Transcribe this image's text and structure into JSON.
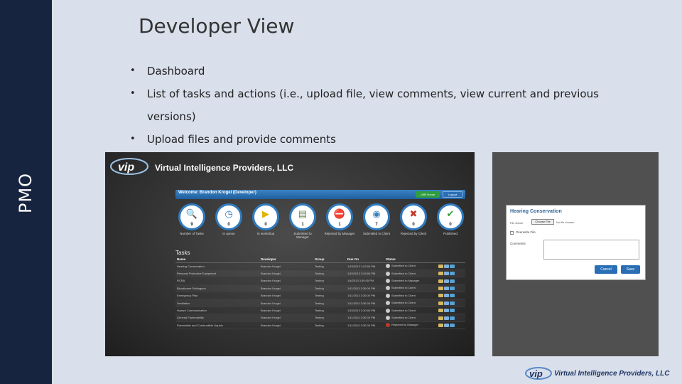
{
  "sidebar": {
    "label": "PMO"
  },
  "slide": {
    "title": "Developer View",
    "bullets": [
      "Dashboard",
      "List of tasks and actions (i.e., upload file, view comments, view current and previous versions)",
      "Upload files and provide comments"
    ]
  },
  "dashboard": {
    "company": "Virtual Intelligence Providers, LLC",
    "welcome": "Welcome: Brandon Krogel (Developer)",
    "lmr_button": "LMR Home",
    "logout_button": "Logout",
    "stats": [
      {
        "count": "9",
        "label": "Number of Tasks",
        "icon": "magnifier-icon"
      },
      {
        "count": "0",
        "label": "In queue",
        "icon": "clock-icon"
      },
      {
        "count": "0",
        "label": "In workshop",
        "icon": "play-icon"
      },
      {
        "count": "1",
        "label": "Submitted to Manager",
        "icon": "document-icon"
      },
      {
        "count": "1",
        "label": "Rejected by Manager",
        "icon": "stop-icon"
      },
      {
        "count": "7",
        "label": "Submitted to Client",
        "icon": "globe-icon"
      },
      {
        "count": "0",
        "label": "Rejected by Client",
        "icon": "x-icon"
      },
      {
        "count": "0",
        "label": "Published",
        "icon": "check-icon"
      }
    ],
    "tasks_title": "Tasks",
    "columns": [
      "Name",
      "Developer",
      "Group",
      "Due On",
      "Status"
    ],
    "rows": [
      {
        "name": "Hearing Conservation",
        "developer": "Brandon Krogel",
        "group": "Testing",
        "due": "1/15/2013 1:03:00 PM",
        "status": "Submitted to Client"
      },
      {
        "name": "Personal Protective Equipment",
        "developer": "Brandon Krogel",
        "group": "Testing",
        "due": "1/15/2013 2:03:00 PM",
        "status": "Submitted to Client"
      },
      {
        "name": "RCRA",
        "developer": "Brandon Krogel",
        "group": "Testing",
        "due": "1/4/2013 3:30:00 PM",
        "status": "Submitted to Manager"
      },
      {
        "name": "Bloodborne Pathogens",
        "developer": "Brandon Krogel",
        "group": "Testing",
        "due": "1/11/2013 3:30:00 PM",
        "status": "Submitted to Client"
      },
      {
        "name": "Emergency Plan",
        "developer": "Brandon Krogel",
        "group": "Testing",
        "due": "1/11/2013 3:30:00 PM",
        "status": "Submitted to Client"
      },
      {
        "name": "Ventilation",
        "developer": "Brandon Krogel",
        "group": "Testing",
        "due": "1/11/2013 3:30:00 PM",
        "status": "Submitted to Client"
      },
      {
        "name": "Hazard Communication",
        "developer": "Brandon Krogel",
        "group": "Testing",
        "due": "1/15/2013 3:30:00 PM",
        "status": "Submitted to Client"
      },
      {
        "name": "General Flammability",
        "developer": "Brandon Krogel",
        "group": "Testing",
        "due": "1/11/2013 3:30:00 PM",
        "status": "Submitted to Client"
      },
      {
        "name": "Flammable and Combustible Liquids",
        "developer": "Brandon Krogel",
        "group": "Testing",
        "due": "1/11/2013 3:30:00 PM",
        "status": "Rejected by Manager"
      }
    ]
  },
  "upload_dialog": {
    "title": "Hearing Conservation",
    "file_label": "File Name",
    "choose_file": "Choose File",
    "no_file": "No file chosen",
    "overwrite_label": "Overwrite File",
    "comments_label": "Comments",
    "cancel_button": "Cancel",
    "save_button": "Save"
  },
  "footer": {
    "company": "Virtual Intelligence Providers, LLC"
  }
}
